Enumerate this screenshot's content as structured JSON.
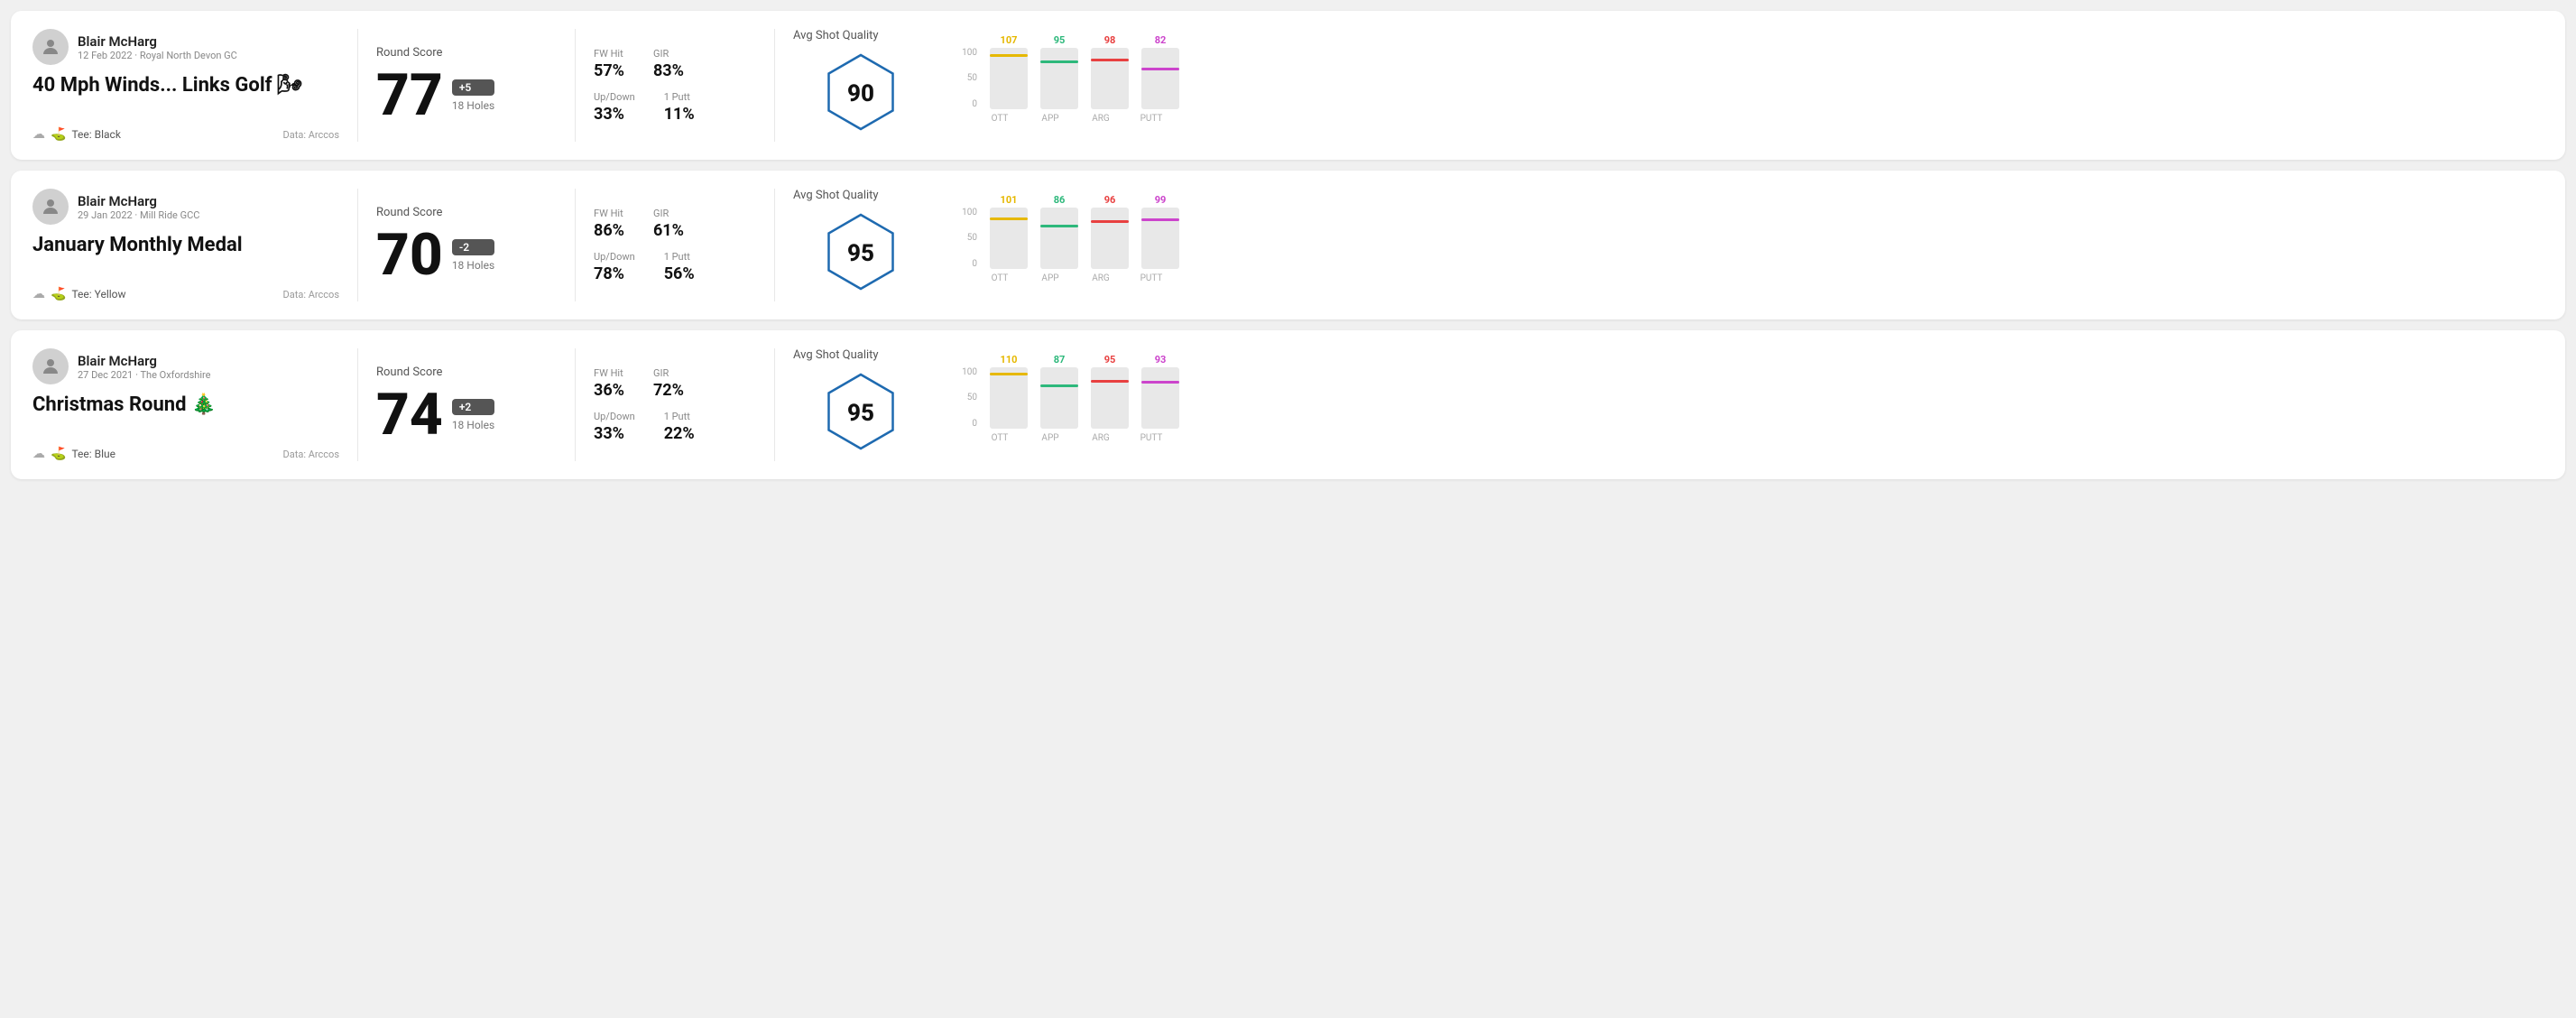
{
  "rounds": [
    {
      "id": "round1",
      "user": {
        "name": "Blair McHarg",
        "meta": "12 Feb 2022 · Royal North Devon GC"
      },
      "title": "40 Mph Winds... Links Golf 🌬",
      "tee": "Tee: Black",
      "data_source": "Data: Arccos",
      "score": "77",
      "score_diff": "+5",
      "score_diff_type": "over",
      "holes": "18 Holes",
      "fw_hit": "57%",
      "gir": "83%",
      "up_down": "33%",
      "one_putt": "11%",
      "avg_shot_quality": "90",
      "chart": {
        "bars": [
          {
            "label": "OTT",
            "value": 107,
            "color": "#e6b800",
            "fill_pct": 85
          },
          {
            "label": "APP",
            "value": 95,
            "color": "#2db87b",
            "fill_pct": 72
          },
          {
            "label": "ARG",
            "value": 98,
            "color": "#e84040",
            "fill_pct": 76
          },
          {
            "label": "PUTT",
            "value": 82,
            "color": "#cc44cc",
            "fill_pct": 60
          }
        ]
      }
    },
    {
      "id": "round2",
      "user": {
        "name": "Blair McHarg",
        "meta": "29 Jan 2022 · Mill Ride GCC"
      },
      "title": "January Monthly Medal",
      "tee": "Tee: Yellow",
      "data_source": "Data: Arccos",
      "score": "70",
      "score_diff": "-2",
      "score_diff_type": "under",
      "holes": "18 Holes",
      "fw_hit": "86%",
      "gir": "61%",
      "up_down": "78%",
      "one_putt": "56%",
      "avg_shot_quality": "95",
      "chart": {
        "bars": [
          {
            "label": "OTT",
            "value": 101,
            "color": "#e6b800",
            "fill_pct": 80
          },
          {
            "label": "APP",
            "value": 86,
            "color": "#2db87b",
            "fill_pct": 65
          },
          {
            "label": "ARG",
            "value": 96,
            "color": "#e84040",
            "fill_pct": 75
          },
          {
            "label": "PUTT",
            "value": 99,
            "color": "#cc44cc",
            "fill_pct": 78
          }
        ]
      }
    },
    {
      "id": "round3",
      "user": {
        "name": "Blair McHarg",
        "meta": "27 Dec 2021 · The Oxfordshire"
      },
      "title": "Christmas Round 🎄",
      "tee": "Tee: Blue",
      "data_source": "Data: Arccos",
      "score": "74",
      "score_diff": "+2",
      "score_diff_type": "over",
      "holes": "18 Holes",
      "fw_hit": "36%",
      "gir": "72%",
      "up_down": "33%",
      "one_putt": "22%",
      "avg_shot_quality": "95",
      "chart": {
        "bars": [
          {
            "label": "OTT",
            "value": 110,
            "color": "#e6b800",
            "fill_pct": 88
          },
          {
            "label": "APP",
            "value": 87,
            "color": "#2db87b",
            "fill_pct": 66
          },
          {
            "label": "ARG",
            "value": 95,
            "color": "#e84040",
            "fill_pct": 74
          },
          {
            "label": "PUTT",
            "value": 93,
            "color": "#cc44cc",
            "fill_pct": 72
          }
        ]
      }
    }
  ],
  "labels": {
    "round_score": "Round Score",
    "avg_shot_quality": "Avg Shot Quality",
    "fw_hit": "FW Hit",
    "gir": "GIR",
    "up_down": "Up/Down",
    "one_putt": "1 Putt",
    "data_arccos": "Data: Arccos",
    "y_100": "100",
    "y_50": "50",
    "y_0": "0"
  }
}
